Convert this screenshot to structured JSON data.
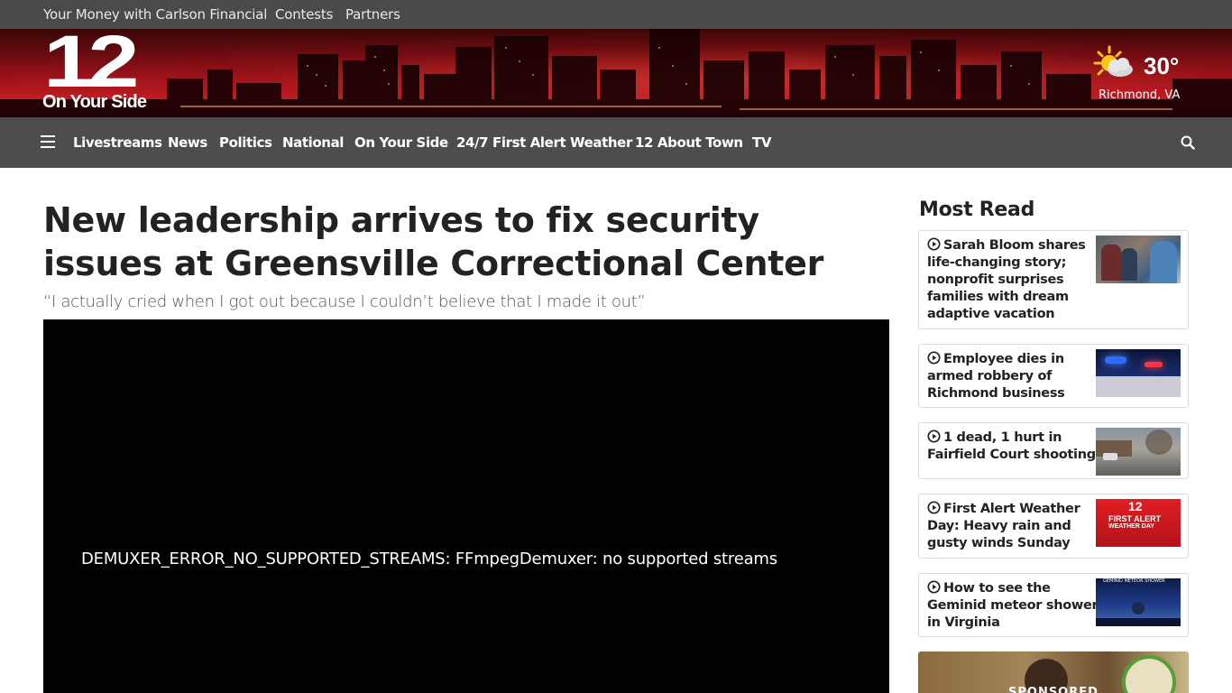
{
  "topbar": {
    "links": [
      "Your Money with Carlson Financial",
      "Contests",
      "Partners"
    ]
  },
  "logo": {
    "number": "12",
    "tagline": "On Your Side",
    "icon": "station-logo"
  },
  "weather": {
    "icon": "partly-cloudy-sun-icon",
    "temperature": "30°",
    "location": "Richmond, VA"
  },
  "nav": {
    "menu_icon": "hamburger-menu-icon",
    "items": [
      "Livestreams",
      "News",
      "Politics",
      "National",
      "On Your Side",
      "24/7 First Alert Weather",
      "12 About Town",
      "TV"
    ],
    "search_icon": "search-icon"
  },
  "article": {
    "title": "New leadership arrives to fix security issues at Greensville Correctional Center",
    "subtitle": "“I actually cried when I got out because I couldn’t believe that I made it out”",
    "video_error": "DEMUXER_ERROR_NO_SUPPORTED_STREAMS: FFmpegDemuxer: no supported streams"
  },
  "most_read": {
    "title": "Most Read",
    "items": [
      {
        "title": "Sarah Bloom shares life-changing story; nonprofit surprises families with dream adaptive vacation",
        "icon": "play-circle-icon"
      },
      {
        "title": "Employee dies in armed robbery of Richmond business",
        "icon": "play-circle-icon"
      },
      {
        "title": "1 dead, 1 hurt in Fairfield Court shooting",
        "icon": "play-circle-icon"
      },
      {
        "title": "First Alert Weather Day: Heavy rain and gusty winds Sunday",
        "icon": "play-circle-icon",
        "thumb_text": [
          "12",
          "FIRST ALERT",
          "WEATHER DAY"
        ]
      },
      {
        "title": "How to see the Geminid meteor shower in Virginia",
        "icon": "play-circle-icon",
        "thumb_text": "GEMINID METEOR SHOWER"
      }
    ]
  },
  "sponsored": {
    "label": "SPONSORED"
  },
  "colors": {
    "topbar": "#4a4a4a",
    "navbar": "#4d4d4d",
    "banner_red": "#c01f22",
    "text": "#222222"
  }
}
